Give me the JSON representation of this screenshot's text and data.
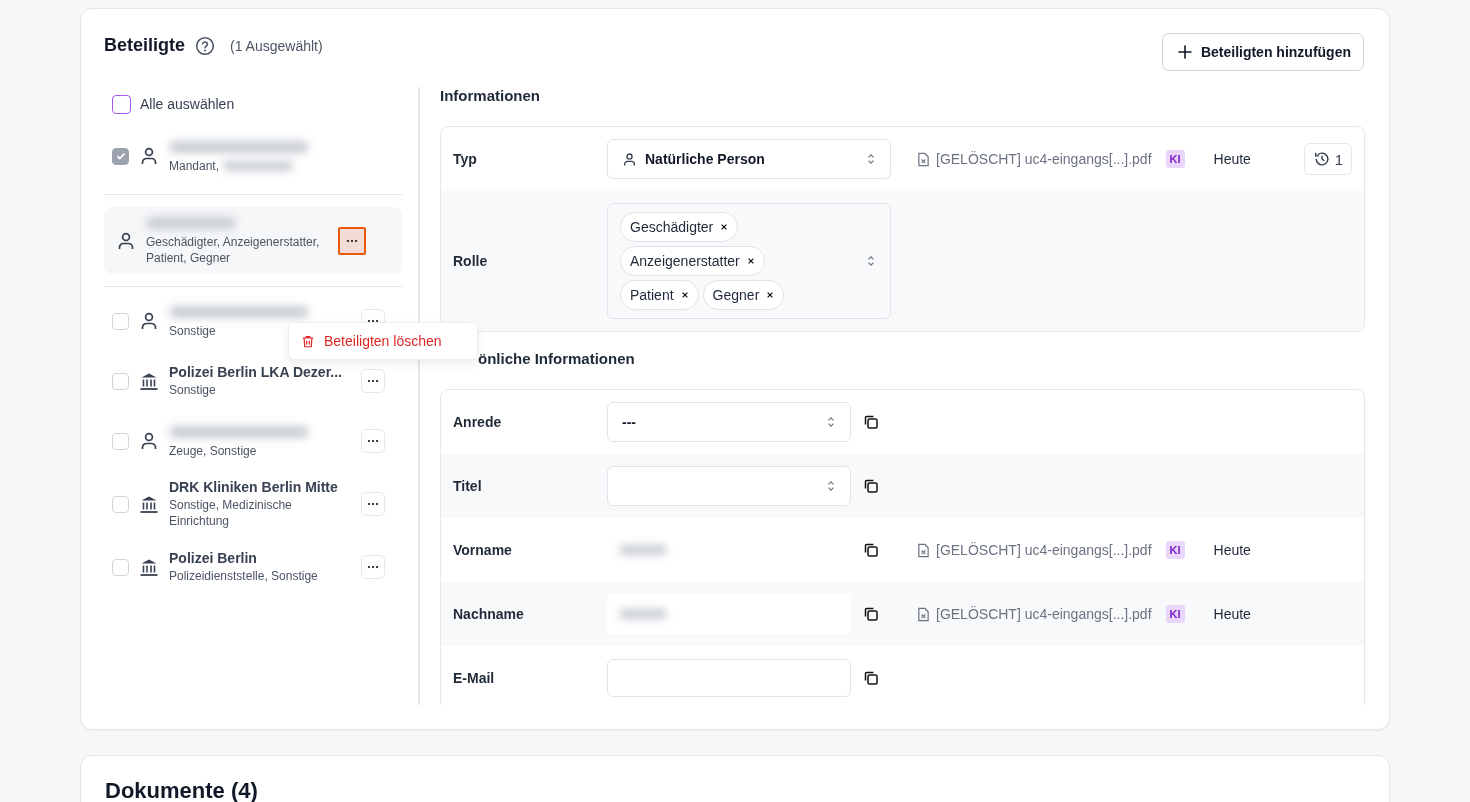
{
  "participants_card": {
    "title": "Beteiligte",
    "selection_count": "(1 Ausgewählt)",
    "add_button": "Beteiligten hinzufügen",
    "select_all": {
      "label": "Alle auswählen",
      "checked": false
    },
    "participants": [
      {
        "kind": "person",
        "name_redacted": true,
        "roles": "Mandant,",
        "roles_redacted": true,
        "checked": true,
        "active": false,
        "menu_button": false
      },
      {
        "kind": "divider"
      },
      {
        "kind": "person",
        "name_redacted": true,
        "roles": "Geschädigter, Anzeigenerstatter, Patient, Gegner",
        "active": true,
        "menu_button": true
      },
      {
        "kind": "divider"
      },
      {
        "kind": "person",
        "name_redacted": true,
        "roles": "Sonstige",
        "checked": false,
        "active": false,
        "menu_button": true
      },
      {
        "kind": "institution",
        "name": "Polizei Berlin LKA Dezer...",
        "roles": "Sonstige",
        "checked": false,
        "active": false,
        "menu_button": true
      },
      {
        "kind": "person",
        "name_redacted": true,
        "roles": "Zeuge, Sonstige",
        "checked": false,
        "active": false,
        "menu_button": true
      },
      {
        "kind": "institution",
        "name": "DRK Kliniken Berlin Mitte",
        "roles": "Sonstige, Medizinische Einrichtung",
        "checked": false,
        "active": false,
        "menu_button": true
      },
      {
        "kind": "institution",
        "name": "Polizei Berlin",
        "roles": "Polizeidienststelle, Sonstige",
        "checked": false,
        "active": false,
        "menu_button": true
      }
    ],
    "context_menu": {
      "items": [
        {
          "label": "Beteiligten löschen",
          "kind": "danger"
        }
      ]
    },
    "sections": [
      {
        "title": "Informationen",
        "wide": true,
        "rows": [
          {
            "label": "Typ",
            "kind": "person_select",
            "value": "Natürliche Person",
            "source": "[GELÖSCHT] uc4-eingangs[...].pdf",
            "badge": "KI",
            "date": "Heute",
            "history": "1"
          },
          {
            "label": "Rolle",
            "kind": "tags",
            "tags": [
              "Geschädigter",
              "Anzeigenerstatter",
              "Patient",
              "Gegner"
            ]
          }
        ]
      },
      {
        "title": "önliche Informationen",
        "wide": false,
        "rows": [
          {
            "label": "Anrede",
            "kind": "select",
            "value": "---"
          },
          {
            "label": "Titel",
            "kind": "select"
          },
          {
            "label": "Vorname",
            "kind": "redacted",
            "source": "[GELÖSCHT] uc4-eingangs[...].pdf",
            "badge": "KI",
            "date": "Heute"
          },
          {
            "label": "Nachname",
            "kind": "redacted",
            "source": "[GELÖSCHT] uc4-eingangs[...].pdf",
            "badge": "KI",
            "date": "Heute"
          },
          {
            "label": "E-Mail",
            "kind": "input"
          }
        ]
      }
    ]
  },
  "documents_card": {
    "title": "Dokumente (4)"
  }
}
